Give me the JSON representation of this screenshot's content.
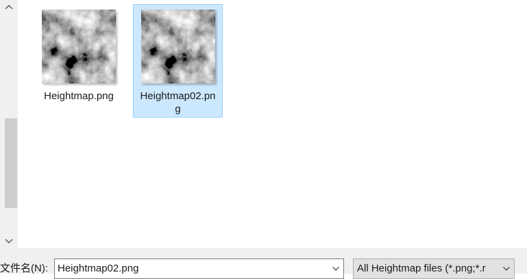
{
  "files": [
    {
      "name": "Heightmap.png",
      "selected": false,
      "thumbnail_icon": "heightmap-thumbnail"
    },
    {
      "name": "Heightmap02.png",
      "selected": true,
      "thumbnail_icon": "heightmap-thumbnail"
    }
  ],
  "bottom_bar": {
    "filename_label": "文件名(N):",
    "filename_value": "Heightmap02.png",
    "filetype_value": "All Heightmap files (*.png;*.r"
  },
  "scrollbar": {
    "up_icon": "chevron-up-icon",
    "down_icon": "chevron-down-icon"
  },
  "colors": {
    "selection_fill": "#cce8ff",
    "selection_border": "#99d1ff",
    "bar_background": "#f0f0f0",
    "scroll_thumb": "#cdcdcd"
  }
}
